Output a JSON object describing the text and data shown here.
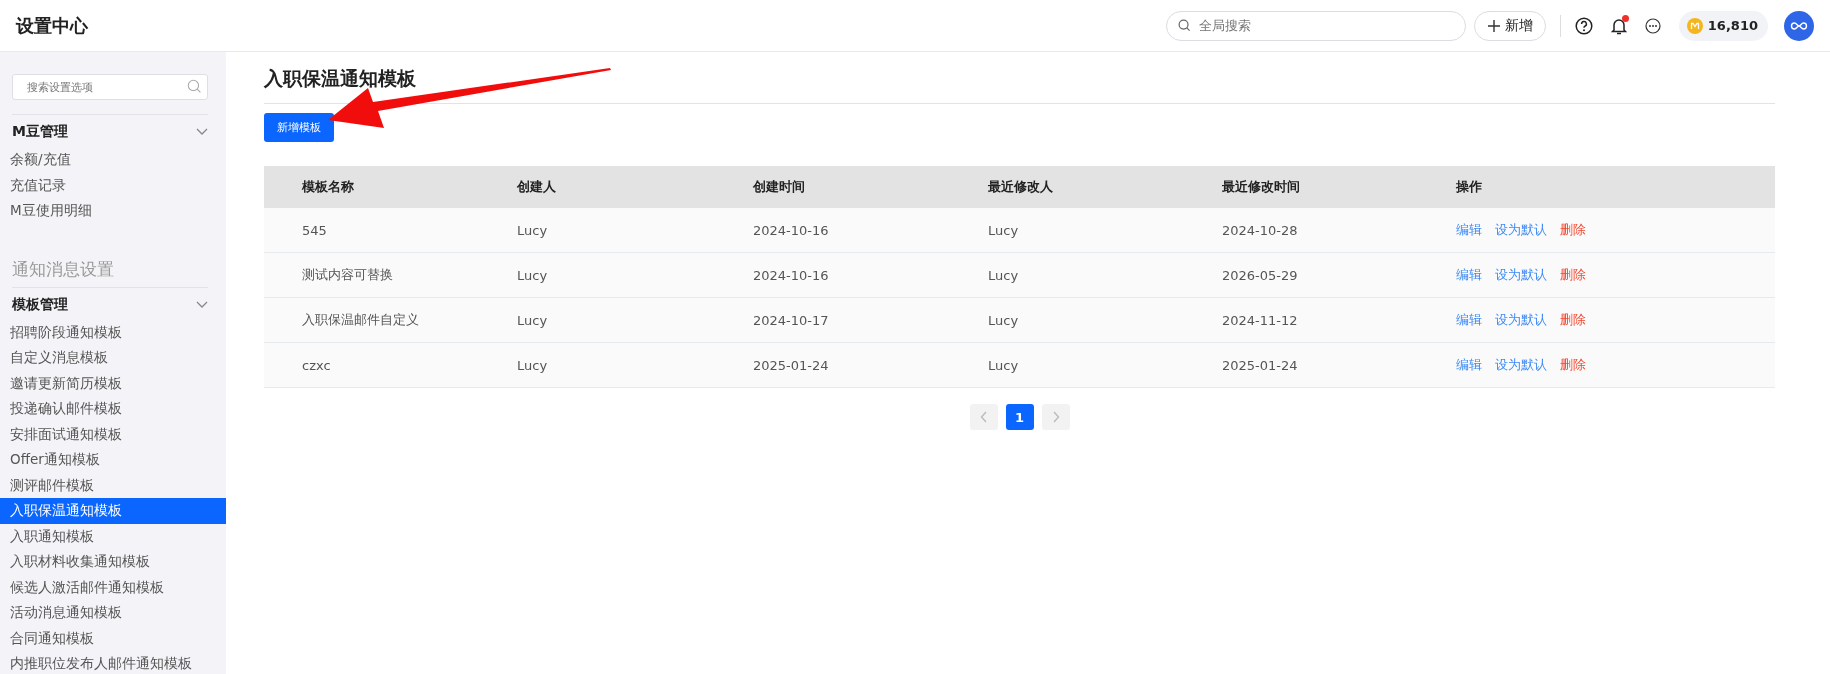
{
  "header": {
    "title": "设置中心",
    "search": {
      "placeholder": "全局搜索"
    },
    "add_button": "新增",
    "coins": "16,810",
    "notification_unread": true
  },
  "sidebar": {
    "search": {
      "placeholder": "搜索设置选项"
    },
    "sections": [
      {
        "groups": [
          {
            "title": "M豆管理",
            "expanded": true,
            "items": [
              {
                "label": "余额/充值",
                "selected": false
              },
              {
                "label": "充值记录",
                "selected": false
              },
              {
                "label": "M豆使用明细",
                "selected": false
              }
            ]
          }
        ]
      },
      {
        "title": "通知消息设置",
        "groups": [
          {
            "title": "模板管理",
            "expanded": true,
            "items": [
              {
                "label": "招聘阶段通知模板",
                "selected": false
              },
              {
                "label": "自定义消息模板",
                "selected": false
              },
              {
                "label": "邀请更新简历模板",
                "selected": false
              },
              {
                "label": "投递确认邮件模板",
                "selected": false
              },
              {
                "label": "安排面试通知模板",
                "selected": false
              },
              {
                "label": "Offer通知模板",
                "selected": false
              },
              {
                "label": "测评邮件模板",
                "selected": false
              },
              {
                "label": "入职保温通知模板",
                "selected": true
              },
              {
                "label": "入职通知模板",
                "selected": false
              },
              {
                "label": "入职材料收集通知模板",
                "selected": false
              },
              {
                "label": "候选人激活邮件通知模板",
                "selected": false
              },
              {
                "label": "活动消息通知模板",
                "selected": false
              },
              {
                "label": "合同通知模板",
                "selected": false
              },
              {
                "label": "内推职位发布人邮件通知模板",
                "selected": false
              }
            ]
          }
        ]
      }
    ]
  },
  "main": {
    "title": "入职保温通知模板",
    "add_button": "新增模板",
    "table": {
      "columns": [
        "模板名称",
        "创建人",
        "创建时间",
        "最近修改人",
        "最近修改时间",
        "操作"
      ],
      "rows": [
        {
          "cells": [
            "545",
            "Lucy",
            "2024-10-16",
            "Lucy",
            "2024-10-28"
          ],
          "actions": [
            {
              "label": "编辑",
              "kind": "link"
            },
            {
              "label": "设为默认",
              "kind": "link"
            },
            {
              "label": "删除",
              "kind": "danger"
            }
          ]
        },
        {
          "cells": [
            "测试内容可替换",
            "Lucy",
            "2024-10-16",
            "Lucy",
            "2026-05-29"
          ],
          "actions": [
            {
              "label": "编辑",
              "kind": "link"
            },
            {
              "label": "设为默认",
              "kind": "link"
            },
            {
              "label": "删除",
              "kind": "danger"
            }
          ]
        },
        {
          "cells": [
            "入职保温邮件自定义",
            "Lucy",
            "2024-10-17",
            "Lucy",
            "2024-11-12"
          ],
          "actions": [
            {
              "label": "编辑",
              "kind": "link"
            },
            {
              "label": "设为默认",
              "kind": "link"
            },
            {
              "label": "删除",
              "kind": "danger"
            }
          ]
        },
        {
          "cells": [
            "czxc",
            "Lucy",
            "2025-01-24",
            "Lucy",
            "2025-01-24"
          ],
          "actions": [
            {
              "label": "编辑",
              "kind": "link"
            },
            {
              "label": "设为默认",
              "kind": "link"
            },
            {
              "label": "删除",
              "kind": "danger"
            }
          ]
        }
      ]
    },
    "pagination": {
      "pages": [
        {
          "label": "1",
          "selected": true
        }
      ],
      "prev_disabled": true,
      "next_disabled": true
    }
  }
}
